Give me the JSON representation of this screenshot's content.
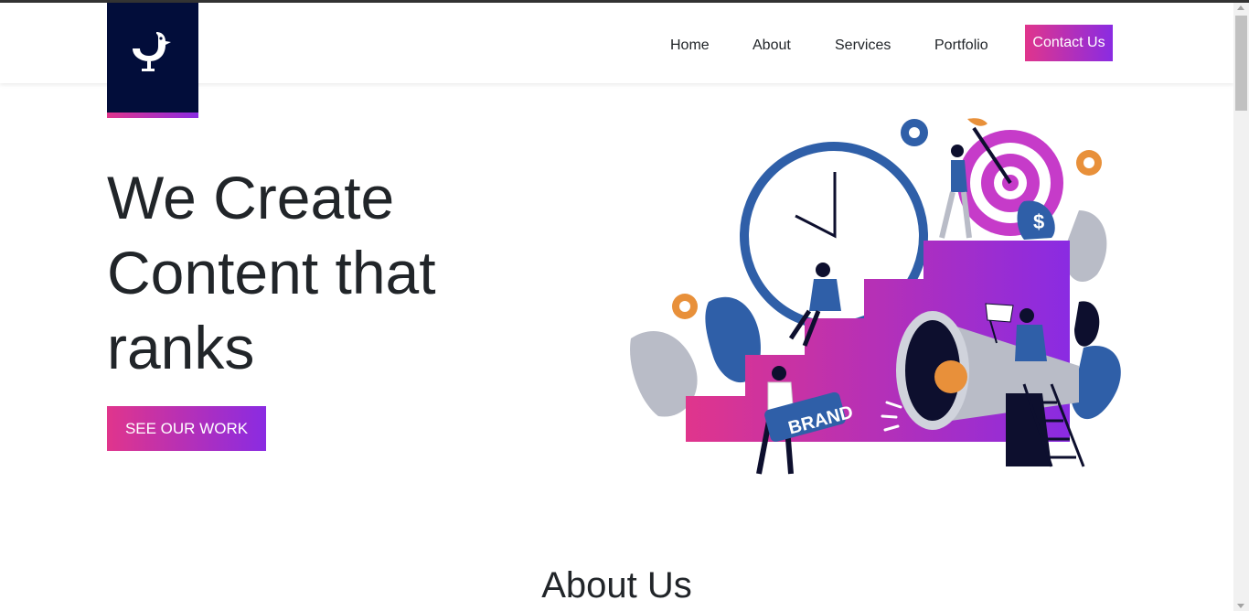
{
  "nav": {
    "items": [
      {
        "label": "Home"
      },
      {
        "label": "About"
      },
      {
        "label": "Services"
      },
      {
        "label": "Portfolio"
      }
    ],
    "contact_label": "Contact Us"
  },
  "hero": {
    "title": "We Create Content that ranks",
    "cta_label": "SEE OUR WORK",
    "illustration_brand_text": "BRAND"
  },
  "about": {
    "title": "About Us"
  },
  "colors": {
    "logo_bg": "#020d3a",
    "gradient_start": "#e0358c",
    "gradient_end": "#8a2be2"
  }
}
